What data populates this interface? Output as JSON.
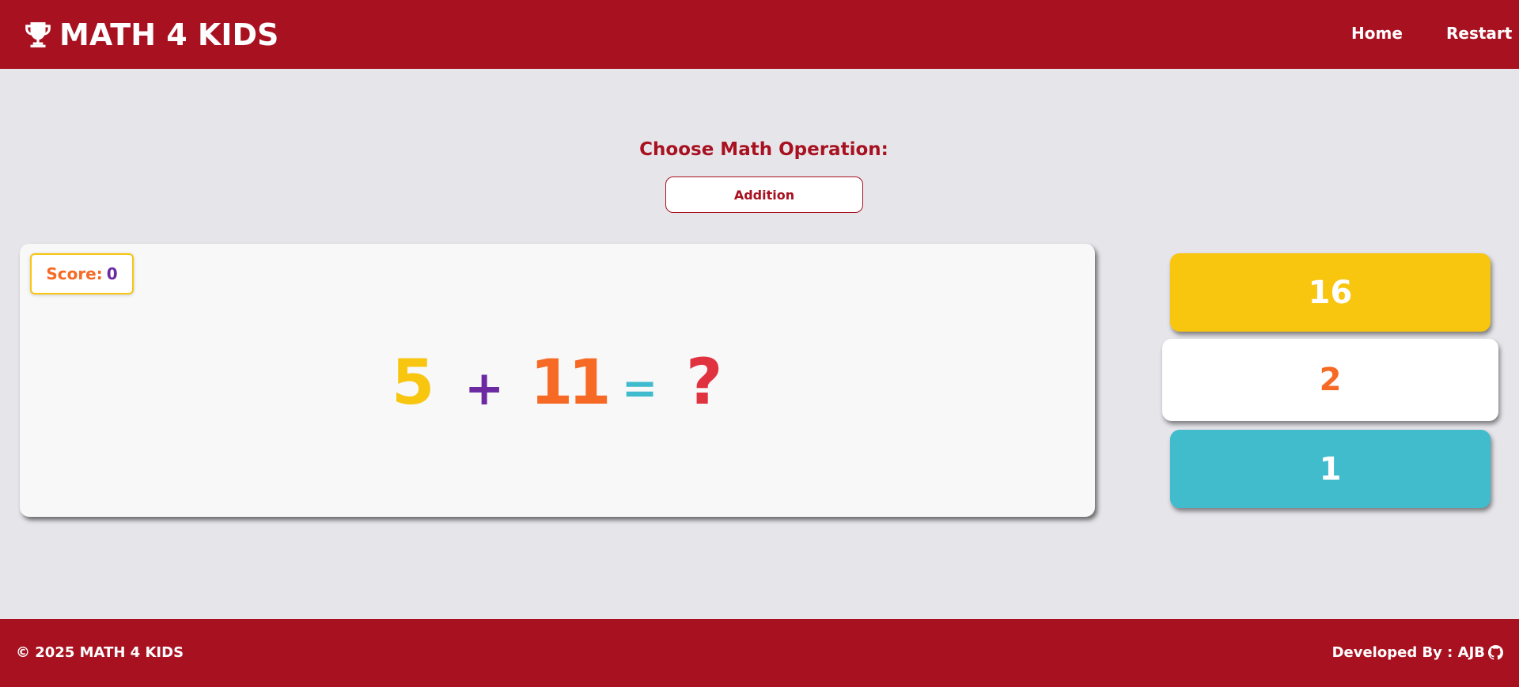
{
  "app": {
    "title": "MATH 4 KIDS",
    "brand_color": "#a81120",
    "logo_icon": "trophy-icon"
  },
  "nav": {
    "home_label": "Home",
    "restart_label": "Restart"
  },
  "operation": {
    "label": "Choose Math Operation:",
    "selected": "Addition"
  },
  "score": {
    "label": "Score:",
    "value": "0"
  },
  "equation": {
    "operand_a": "5",
    "operator": "+",
    "operand_b": "11",
    "equals": "=",
    "unknown": "?"
  },
  "answers": [
    {
      "value": "16",
      "color": "#f8c50f"
    },
    {
      "value": "2",
      "color": "#ffffff"
    },
    {
      "value": "1",
      "color": "#41bccd"
    }
  ],
  "footer": {
    "copyright": "© 2025 MATH 4 KIDS",
    "developer": "Developed By : AJB",
    "developer_icon": "github-icon"
  }
}
